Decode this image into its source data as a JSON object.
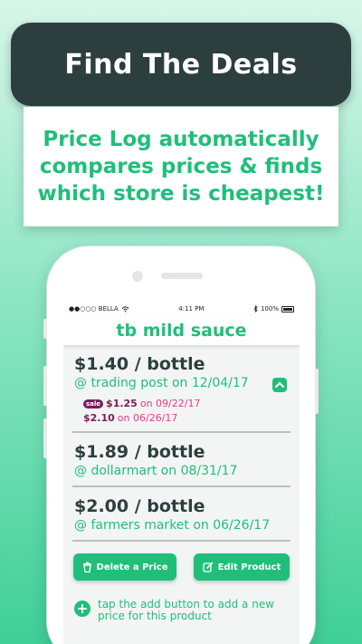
{
  "banner": {
    "title": "Find The Deals"
  },
  "promo": {
    "text": "Price Log automatically compares prices & finds which store is cheapest!"
  },
  "status_bar": {
    "carrier": "●●○○○ BELLA",
    "time": "4:11 PM",
    "battery": "100%"
  },
  "nav": {
    "title": "tb mild sauce"
  },
  "prices": [
    {
      "price": "$1.40 / bottle",
      "store": "@ trading post on 12/04/17",
      "history": [
        {
          "badge": "sale",
          "price": "$1.25",
          "date": "on 09/22/17"
        },
        {
          "badge": "",
          "price": "$2.10",
          "date": "on 06/26/17"
        }
      ]
    },
    {
      "price": "$1.89 / bottle",
      "store": "@ dollarmart on 08/31/17"
    },
    {
      "price": "$2.00 / bottle",
      "store": "@ farmers market on 06/26/17"
    }
  ],
  "actions": {
    "delete_label": "Delete a Price",
    "edit_label": "Edit Product"
  },
  "hint": {
    "text": "tap the add button to add a new price for this product"
  },
  "colors": {
    "accent": "#1fbf7a",
    "dark": "#2c3f3e",
    "sale": "#7a1c5c",
    "sale_date": "#e23a86"
  }
}
